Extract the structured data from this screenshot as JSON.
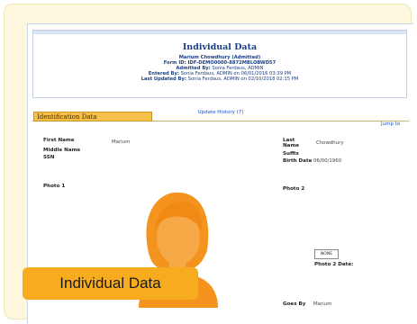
{
  "header": {
    "title": "Individual Data",
    "subject_line": "Marium Chowdhury (Admitted)",
    "form_id": "Form ID: IDF-DEMO0000-8872MBLOBWD57",
    "admitted_by_label": "Admitted By:",
    "admitted_by_value": "Sonia Ferdaus, ADMIN",
    "entered_by_label": "Entered By:",
    "entered_by_value": "Sonia Ferdaus, ADMIN on 06/01/2016 03:39 PM",
    "last_updated_label": "Last Updated By:",
    "last_updated_value": "Sonia Ferdaus, ADMIN on 02/10/2018 02:15 PM",
    "update_history": "Update History (7)"
  },
  "section": {
    "title": "Identification Data",
    "jump_label": "Jump to"
  },
  "fields": {
    "first_name_label": "First Name",
    "first_name_value": "Marium",
    "middle_name_label": "Middle Name",
    "ssn_label": "SSN",
    "photo1_label": "Photo 1",
    "last_name_label": "Last Name",
    "last_name_value": "Chowdhury",
    "suffix_label": "Suffix",
    "birth_date_label": "Birth Date",
    "birth_date_value": "06/00/1960",
    "photo2_label": "Photo 2",
    "none_button": "NONE",
    "photo2_date_label": "Photo 2 Date:",
    "goes_by_label": "Goes By",
    "goes_by_value": "Marium"
  },
  "overlay": {
    "badge_text": "Individual Data"
  },
  "colors": {
    "frame_bg": "#fdf7dd",
    "title_blue": "#1b3f86",
    "section_tab": "#f7c04a",
    "badge": "#f7ac1f",
    "avatar_orange": "#f4931e"
  }
}
